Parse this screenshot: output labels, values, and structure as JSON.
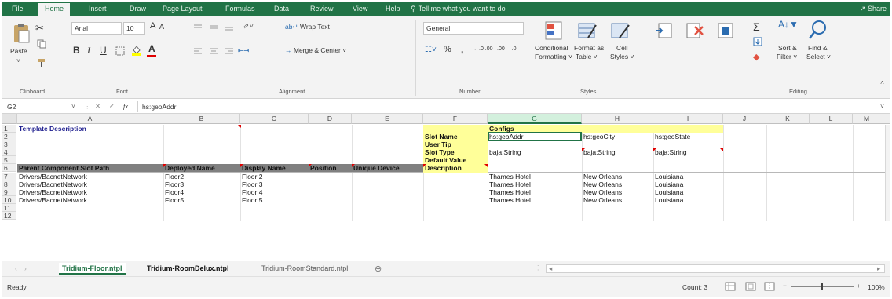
{
  "ribbon_tabs": [
    "File",
    "Home",
    "Insert",
    "Draw",
    "Page Layout",
    "Formulas",
    "Data",
    "Review",
    "View",
    "Help"
  ],
  "tell_me": "Tell me what you want to do",
  "share_label": "Share",
  "clipboard": {
    "paste": "Paste",
    "label": "Clipboard"
  },
  "font": {
    "name": "Arial",
    "size": "10",
    "bold": "B",
    "italic": "I",
    "underline": "U",
    "grow": "A",
    "shrink": "A",
    "color_a": "A",
    "label": "Font"
  },
  "alignment": {
    "wrap_text": "Wrap Text",
    "merge_center": "Merge & Center",
    "label": "Alignment"
  },
  "number": {
    "format": "General",
    "percent": "%",
    "comma": ",",
    "inc_decimal": "←.0 .00",
    "dec_decimal": ".00 →.0",
    "label": "Number"
  },
  "styles": {
    "conditional": "Conditional",
    "formatting": "Formatting ˅",
    "format_as": "Format as",
    "table": "Table ˅",
    "cell": "Cell",
    "cell_styles": "Styles ˅",
    "label": "Styles"
  },
  "cells": {
    "A1": "Template Description",
    "F1": "",
    "G1": "Configs",
    "F2": "Slot Name",
    "F3": "User Tip",
    "F4": "Slot Type",
    "F5": "Default Value",
    "F6": "Description",
    "G2": "hs:geoAddr",
    "H2": "hs:geoCity",
    "I2": "hs:geoState",
    "G4": "baja:String",
    "H4": "baja:String",
    "I4": "baja:String",
    "A6": "Parent Component Slot Path",
    "B6": "Deployed Name",
    "C6": "Display Name",
    "D6": "Position",
    "E6": "Unique Device",
    "data_rows": [
      {
        "A": "Drivers/BacnetNetwork",
        "B": "Floor2",
        "C": "Floor 2",
        "G": "Thames Hotel",
        "H": "New Orleans",
        "I": "Louisiana"
      },
      {
        "A": "Drivers/BacnetNetwork",
        "B": "Floor3",
        "C": "Floor 3",
        "G": "Thames Hotel",
        "H": "New Orleans",
        "I": "Louisiana"
      },
      {
        "A": "Drivers/BacnetNetwork",
        "B": "Floor4",
        "C": "Floor 4",
        "G": "Thames Hotel",
        "H": "New Orleans",
        "I": "Louisiana"
      },
      {
        "A": "Drivers/BacnetNetwork",
        "B": "Floor5",
        "C": "Floor 5",
        "G": "Thames Hotel",
        "H": "New Orleans",
        "I": "Louisiana"
      }
    ]
  },
  "editing": {
    "sort_filter": "Sort &",
    "filter": "Filter ˅",
    "find_select": "Find &",
    "select": "Select ˅",
    "label": "Editing"
  },
  "formula_bar": {
    "name_box": "G2",
    "fx": "fx",
    "formula": "hs:geoAddr"
  },
  "columns": [
    "A",
    "B",
    "C",
    "D",
    "E",
    "F",
    "G",
    "H",
    "I",
    "J",
    "K",
    "L",
    "M"
  ],
  "rows": [
    "1",
    "2",
    "3",
    "4",
    "5",
    "6",
    "7",
    "8",
    "9",
    "10",
    "11",
    "12"
  ],
  "sheets": [
    "Tridium-Floor.ntpl",
    "Tridium-RoomDelux.ntpl",
    "Tridium-RoomStandard.ntpl"
  ],
  "status": {
    "ready": "Ready",
    "count": "Count: 3",
    "zoom": "100%"
  },
  "colors": {
    "excel_green": "#217346",
    "highlight_yellow": "#ffff99",
    "header_gray": "#808080"
  }
}
